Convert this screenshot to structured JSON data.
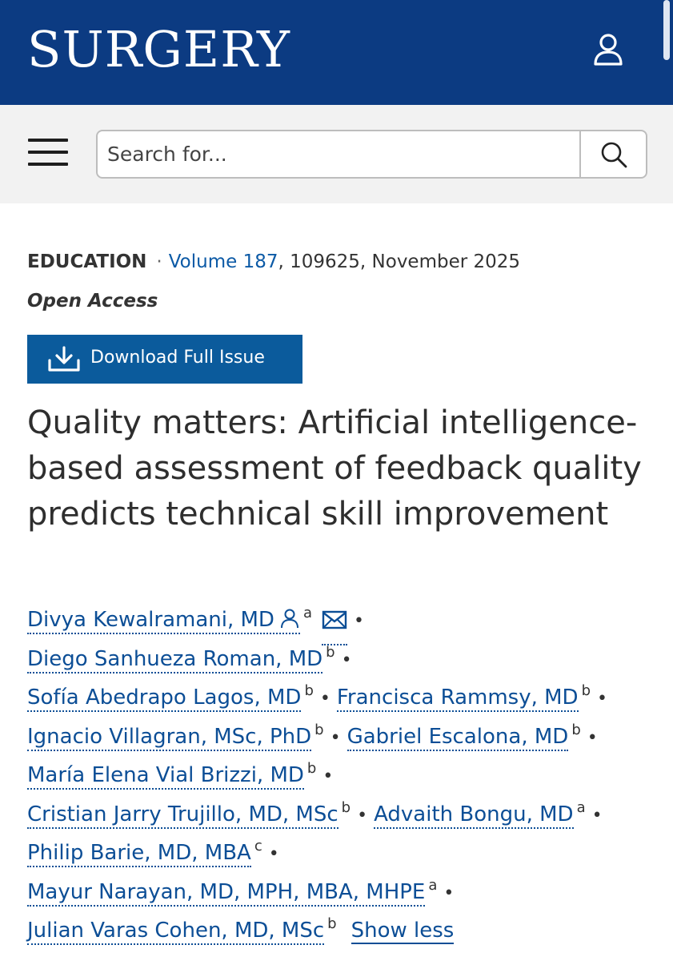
{
  "header": {
    "brand": "SURGERY",
    "user_icon": "user-icon"
  },
  "search": {
    "placeholder": "Search for...",
    "menu_icon": "hamburger-menu-icon",
    "search_icon": "search-icon"
  },
  "article": {
    "section": "EDUCATION",
    "separator": "·",
    "volume_link": "Volume 187",
    "volume_rest": ", 109625, November 2025",
    "access": "Open Access",
    "download_label": "Download Full Issue",
    "title": "Quality matters: Artificial intelligence-based assessment of feedback quality predicts technical skill improvement"
  },
  "authors": [
    {
      "name": "Divya Kewalramani, MD",
      "aff": "a"
    },
    {
      "name": "Diego Sanhueza Roman, MD",
      "aff": "b"
    },
    {
      "name": "Sofía Abedrapo Lagos, MD",
      "aff": "b"
    },
    {
      "name": "Francisca Rammsy, MD",
      "aff": "b"
    },
    {
      "name": "Ignacio Villagran, MSc, PhD",
      "aff": "b"
    },
    {
      "name": "Gabriel Escalona, MD",
      "aff": "b"
    },
    {
      "name": "María Elena Vial Brizzi, MD",
      "aff": "b"
    },
    {
      "name": "Cristian Jarry Trujillo, MD, MSc",
      "aff": "b"
    },
    {
      "name": "Advaith Bongu, MD",
      "aff": "a"
    },
    {
      "name": "Philip Barie, MD, MBA",
      "aff": "c"
    },
    {
      "name": "Mayur Narayan, MD, MPH, MBA, MHPE",
      "aff": "a"
    },
    {
      "name": "Julian Varas Cohen, MD, MSc",
      "aff": "b"
    }
  ],
  "show_less": "Show less",
  "bullet": "•",
  "colors": {
    "header_bg": "#0c3b82",
    "button_bg": "#0b5b9c",
    "link": "#0c4e96"
  }
}
